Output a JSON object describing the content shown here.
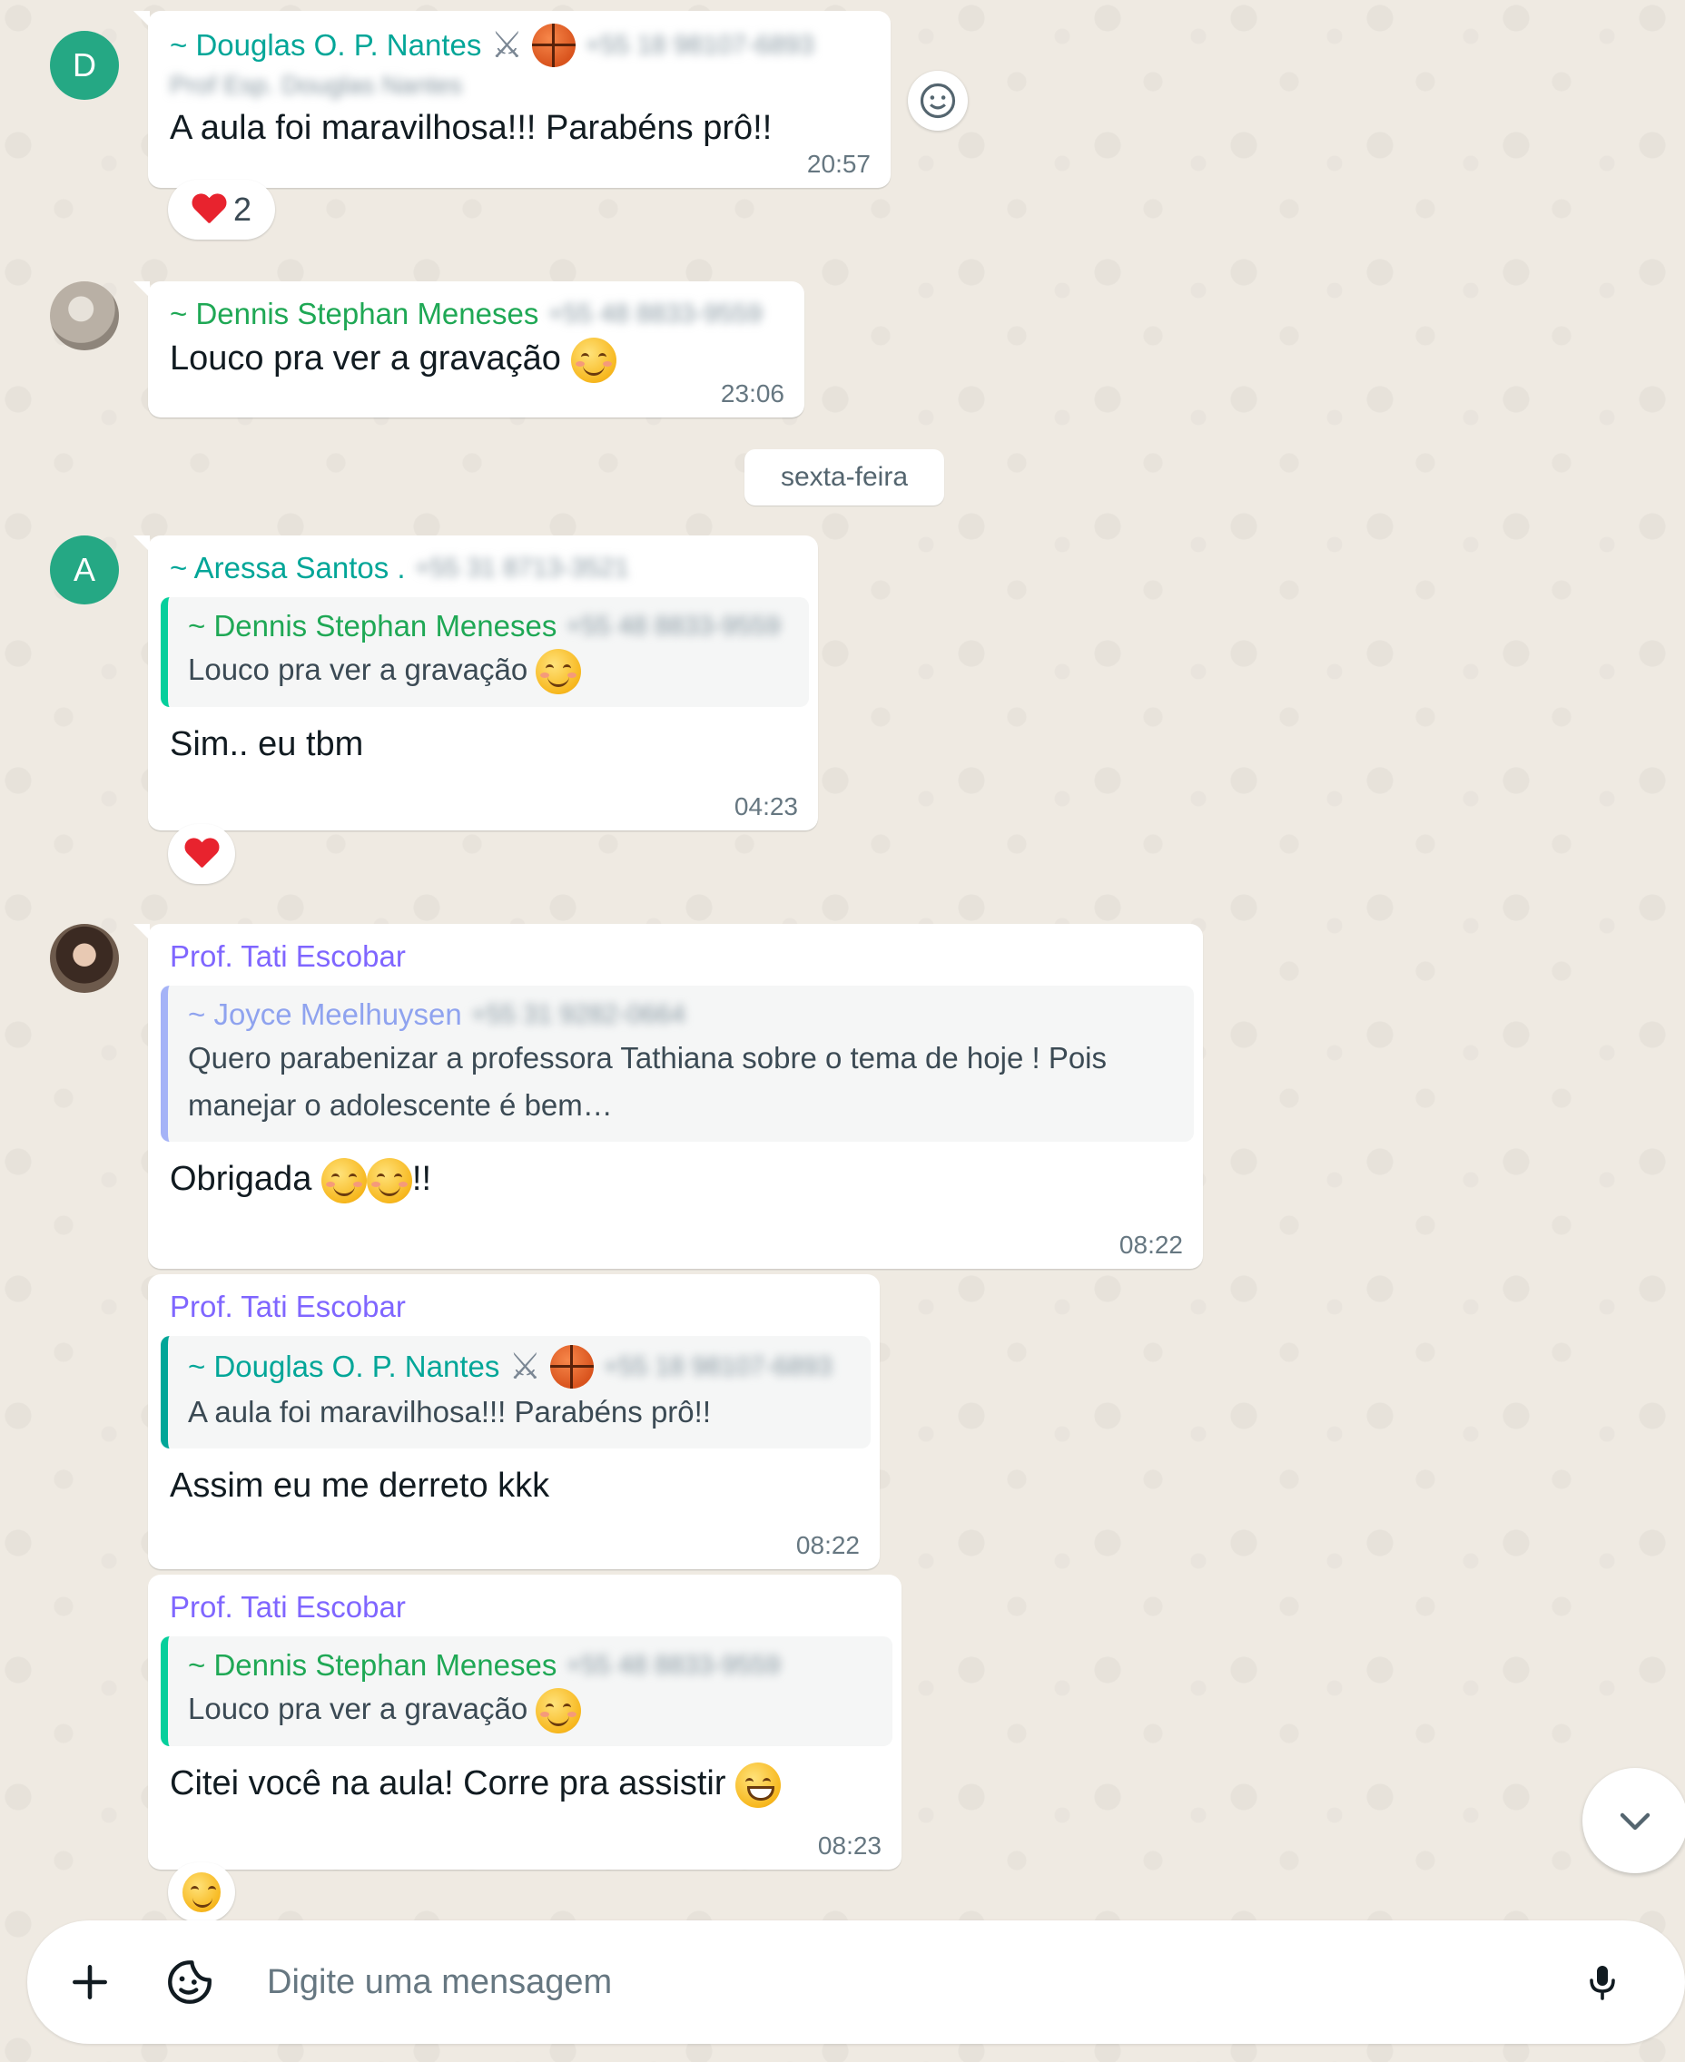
{
  "messages": [
    {
      "sender": "~ Douglas O. P. Nantes",
      "phone": "+55 18 98107-6893",
      "subname": "Prof Esp. Douglas Nantes",
      "text": "A aula foi maravilhosa!!! Parabéns prô!!",
      "time": "20:57",
      "reaction_count": "2"
    },
    {
      "sender": "~ Dennis Stephan Meneses",
      "phone": "+55 48 8833-9559",
      "text": "Louco pra ver a gravação",
      "time": "23:06"
    },
    {
      "sender": "~ Aressa Santos .",
      "phone": "+55 31 8713-3521",
      "quote_sender": "~ Dennis Stephan Meneses",
      "quote_phone": "+55 48 8833-9559",
      "quote_text": "Louco pra ver a gravação",
      "text": "Sim.. eu tbm",
      "time": "04:23"
    },
    {
      "sender": "Prof. Tati Escobar",
      "quote_sender": "~ Joyce Meelhuysen",
      "quote_phone": "+55 31 9282-0664",
      "quote_text_1": "Quero parabenizar a professora Tathiana sobre o tema de hoje ! Pois",
      "quote_text_2": "manejar o adolescente é bem…",
      "text": "Obrigada",
      "text_suffix": "!!",
      "time": "08:22"
    },
    {
      "sender": "Prof. Tati Escobar",
      "quote_sender": "~ Douglas O. P. Nantes",
      "quote_phone": "+55 18 98107-6893",
      "quote_text": "A aula foi maravilhosa!!! Parabéns prô!!",
      "text": "Assim eu me derreto kkk",
      "time": "08:22"
    },
    {
      "sender": "Prof. Tati Escobar",
      "quote_sender": "~ Dennis Stephan Meneses",
      "quote_phone": "+55 48 8833-9559",
      "quote_text": "Louco pra ver a gravação",
      "text": "Citei você na aula! Corre pra assistir",
      "time": "08:23"
    }
  ],
  "avatars": {
    "douglas": "D",
    "aressa": "A"
  },
  "date_separator": "sexta-feira",
  "composer": {
    "placeholder": "Digite uma mensagem"
  },
  "icons": [
    "smiley-icon",
    "heart-icon",
    "chevron-down-icon",
    "plus-icon",
    "sticker-icon",
    "microphone-icon",
    "crossed-swords-icon",
    "basketball-icon"
  ],
  "colors": {
    "background": "#efeae2",
    "bubble": "#ffffff",
    "name_green": "#1fa855",
    "name_purple": "#7f66ff"
  }
}
